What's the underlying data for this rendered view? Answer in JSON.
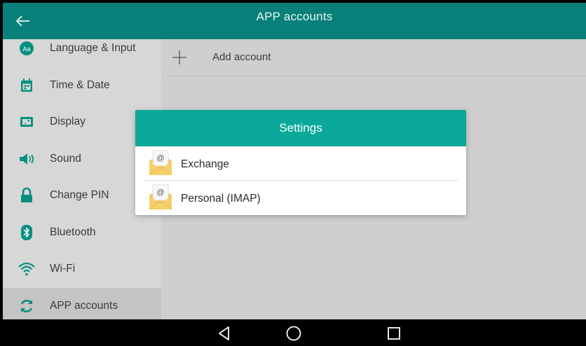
{
  "appbar": {
    "title": "APP accounts",
    "back_icon": "arrow-left-icon"
  },
  "sidebar": {
    "items": [
      {
        "label": "Language & Input",
        "icon": "language-icon"
      },
      {
        "label": "Time & Date",
        "icon": "calendar-icon"
      },
      {
        "label": "Display",
        "icon": "display-icon"
      },
      {
        "label": "Sound",
        "icon": "speaker-icon"
      },
      {
        "label": "Change PIN",
        "icon": "lock-icon"
      },
      {
        "label": "Bluetooth",
        "icon": "bluetooth-icon"
      },
      {
        "label": "Wi-Fi",
        "icon": "wifi-icon"
      },
      {
        "label": "APP accounts",
        "icon": "sync-icon",
        "active": true
      }
    ]
  },
  "main": {
    "add_account_label": "Add account"
  },
  "dialog": {
    "title": "Settings",
    "options": [
      {
        "label": "Exchange",
        "icon": "mail-envelope-icon"
      },
      {
        "label": "Personal (IMAP)",
        "icon": "mail-envelope-icon"
      }
    ]
  },
  "colors": {
    "appbar": "#09807a",
    "accent": "#0aa89a",
    "icon_green": "#08907f",
    "sidebar_bg": "#d7d7d7",
    "main_bg": "#cfcfcf"
  },
  "navbar": {
    "buttons": [
      "back-triangle-icon",
      "home-circle-icon",
      "recents-square-icon"
    ]
  }
}
